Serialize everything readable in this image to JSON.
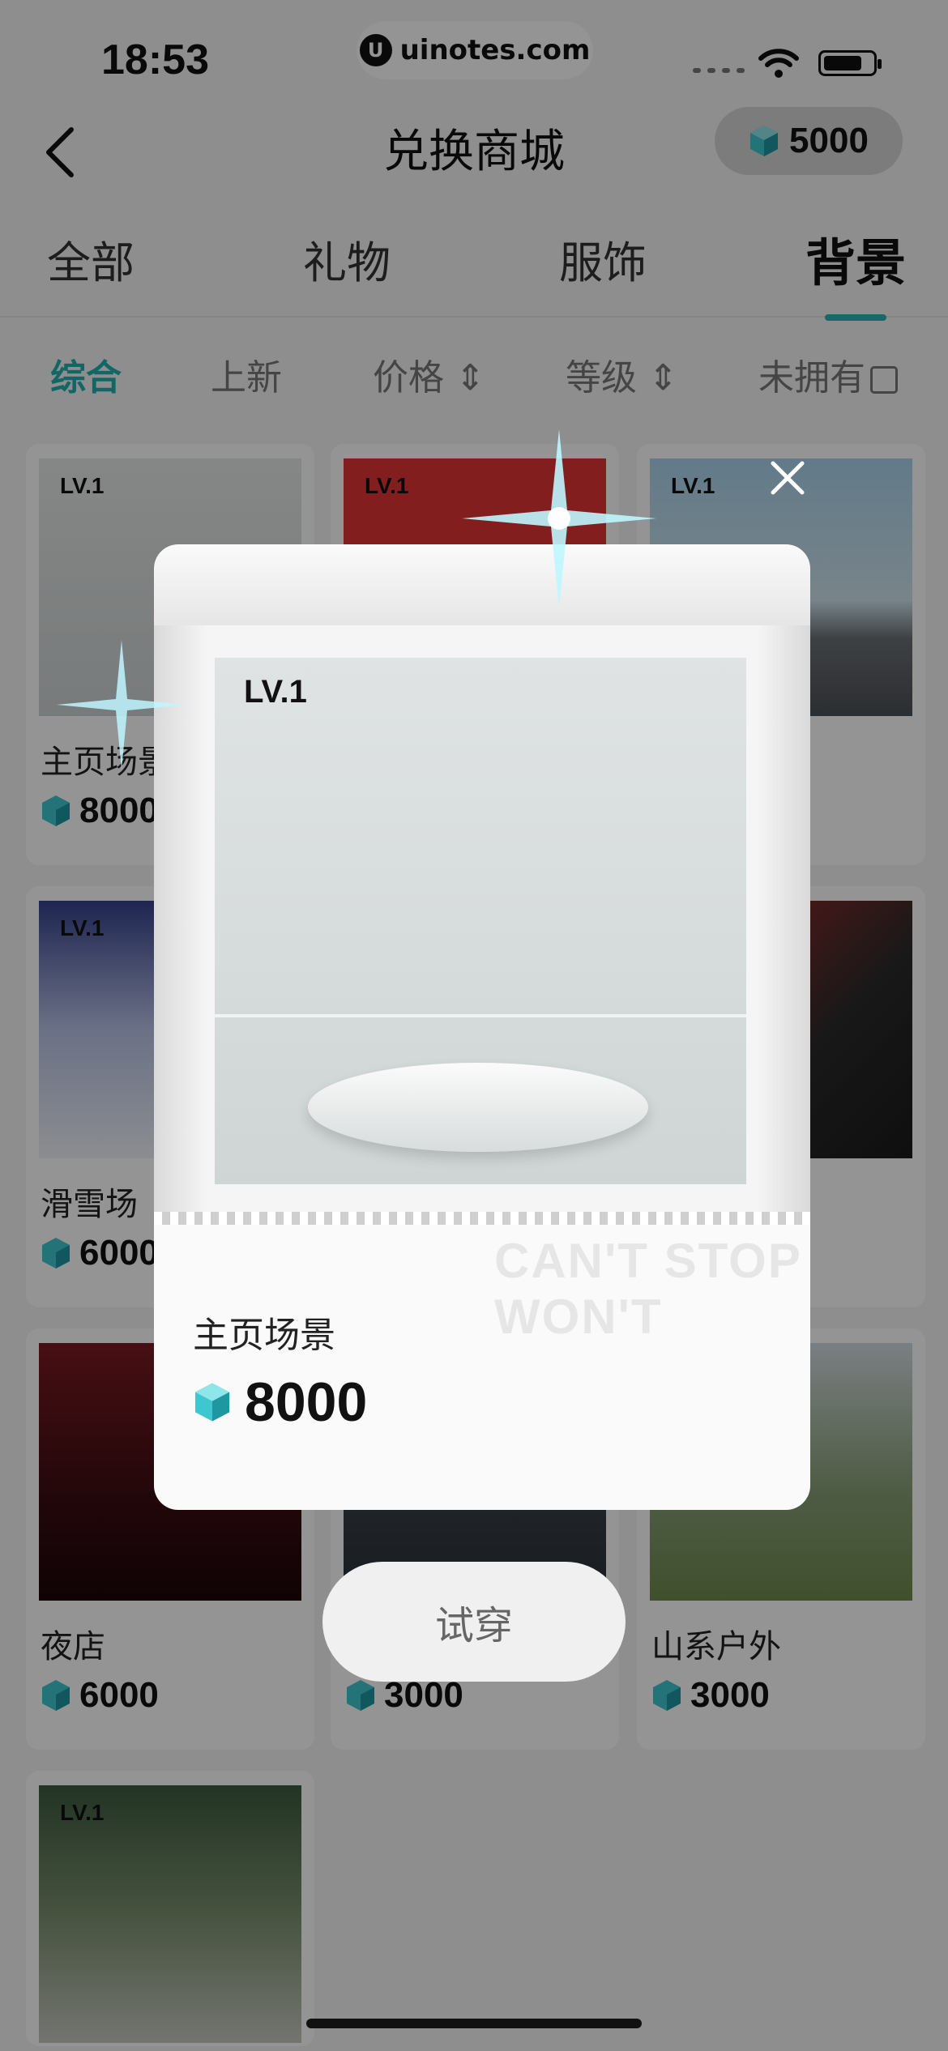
{
  "status": {
    "time": "18:53",
    "watermark": "uinotes.com"
  },
  "header": {
    "title": "兑换商城",
    "coins": "5000"
  },
  "tabs": [
    "全部",
    "礼物",
    "服饰",
    "背景"
  ],
  "filters": {
    "combined": "综合",
    "new": "上新",
    "price": "价格",
    "level": "等级",
    "not_owned": "未拥有"
  },
  "cards": [
    {
      "level": "LV.1",
      "name": "主页场景",
      "price": "8000"
    },
    {
      "level": "LV.1"
    },
    {
      "level": "LV.1"
    },
    {
      "level": "LV.1",
      "name": "滑雪场",
      "price": "6000"
    },
    {
      "name": "夜店",
      "price": "6000"
    },
    {
      "price": "3000"
    },
    {
      "name": "山系户外",
      "price": "3000"
    },
    {
      "level": "LV.1"
    }
  ],
  "modal": {
    "level": "LV.1",
    "name": "主页场景",
    "price": "8000",
    "bg_text": "CAN'T STOP WON'T"
  },
  "try_on": "试穿",
  "colors": {
    "accent": "#1fb0b0",
    "gem": "#3fc7cf"
  }
}
